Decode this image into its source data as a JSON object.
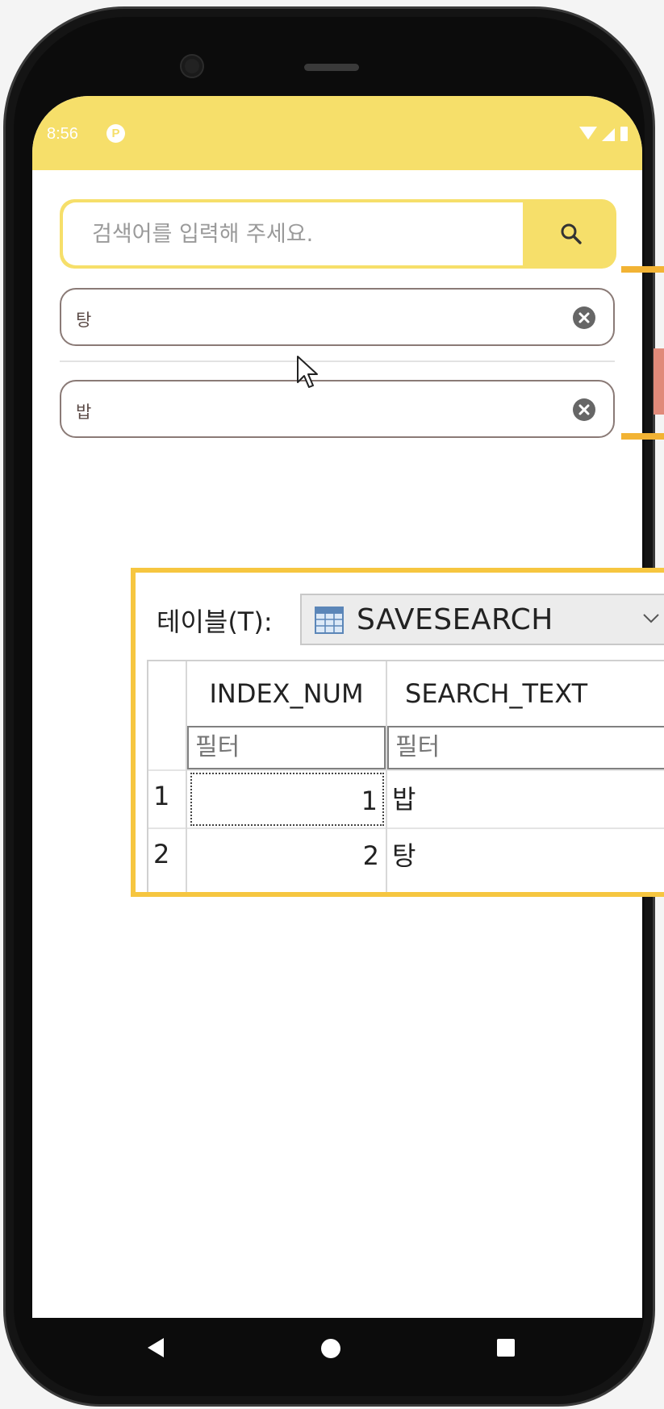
{
  "status_bar": {
    "time": "8:56",
    "app_badge": "P"
  },
  "search": {
    "placeholder": "검색어를 입력해 주세요.",
    "value": ""
  },
  "recent_searches": [
    {
      "text": "탕"
    },
    {
      "text": "밥"
    }
  ],
  "db_viewer": {
    "table_label": "테이블(T):",
    "selected_table": "SAVESEARCH",
    "columns": [
      "INDEX_NUM",
      "SEARCH_TEXT"
    ],
    "filter_placeholder": "필터",
    "rows": [
      {
        "row_number": "1",
        "index_num": "1",
        "search_text": "밥"
      },
      {
        "row_number": "2",
        "index_num": "2",
        "search_text": "탕"
      }
    ]
  },
  "colors": {
    "accent": "#f6df6a",
    "highlight_frame": "#f6c640",
    "marker": "#f2b334"
  },
  "icons": {
    "search_button": "search-icon",
    "clear_button": "clear-circle-icon",
    "nav_back": "back-triangle-icon",
    "nav_home": "home-circle-icon",
    "nav_recent": "recent-square-icon"
  }
}
